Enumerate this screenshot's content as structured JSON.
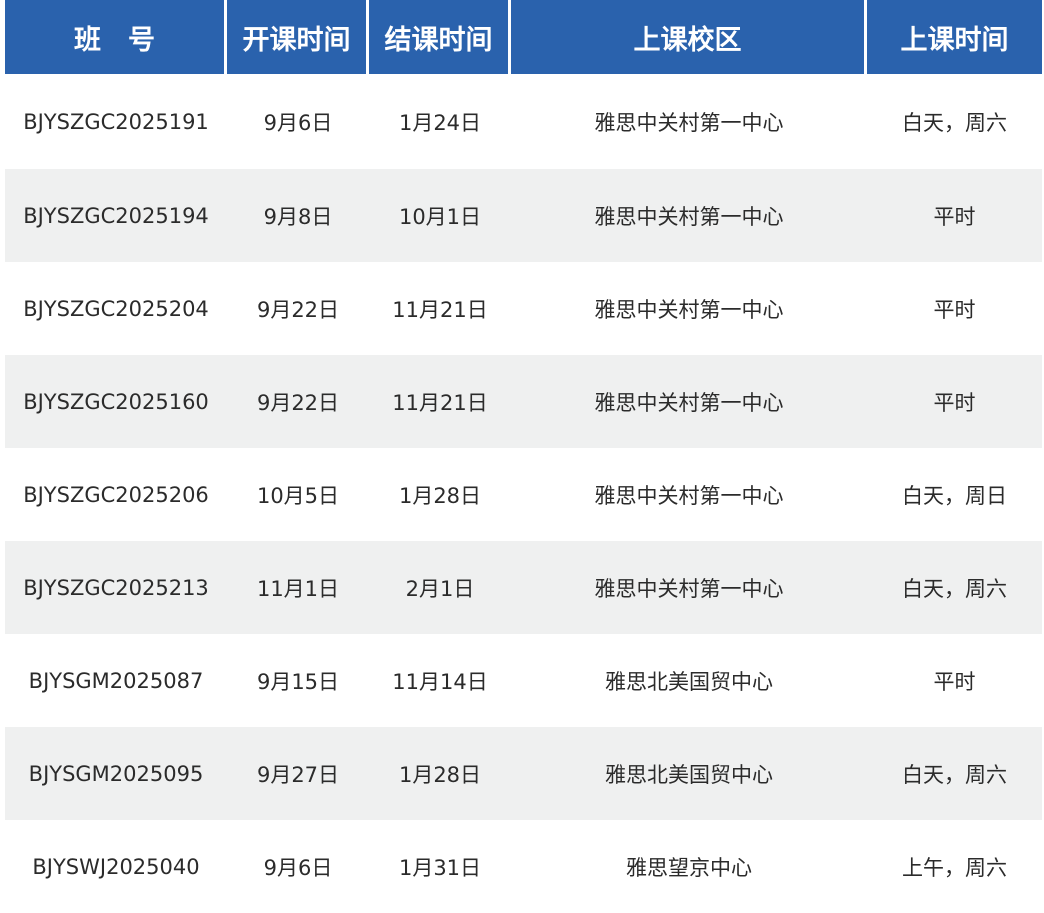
{
  "table": {
    "headers": [
      "班　号",
      "开课时间",
      "结课时间",
      "上课校区",
      "上课时间"
    ],
    "rows": [
      [
        "BJYSZGC2025191",
        "9月6日",
        "1月24日",
        "雅思中关村第一中心",
        "白天，周六"
      ],
      [
        "BJYSZGC2025194",
        "9月8日",
        "10月1日",
        "雅思中关村第一中心",
        "平时"
      ],
      [
        "BJYSZGC2025204",
        "9月22日",
        "11月21日",
        "雅思中关村第一中心",
        "平时"
      ],
      [
        "BJYSZGC2025160",
        "9月22日",
        "11月21日",
        "雅思中关村第一中心",
        "平时"
      ],
      [
        "BJYSZGC2025206",
        "10月5日",
        "1月28日",
        "雅思中关村第一中心",
        "白天，周日"
      ],
      [
        "BJYSZGC2025213",
        "11月1日",
        "2月1日",
        "雅思中关村第一中心",
        "白天，周六"
      ],
      [
        "BJYSGM2025087",
        "9月15日",
        "11月14日",
        "雅思北美国贸中心",
        "平时"
      ],
      [
        "BJYSGM2025095",
        "9月27日",
        "1月28日",
        "雅思北美国贸中心",
        "白天，周六"
      ],
      [
        "BJYSWJ2025040",
        "9月6日",
        "1月31日",
        "雅思望京中心",
        "上午，周六"
      ]
    ]
  },
  "colors": {
    "header_bg": "#2a62ad",
    "header_text": "#ffffff",
    "row_alt_bg": "#eff0f0",
    "body_text": "#2b2b2b"
  }
}
